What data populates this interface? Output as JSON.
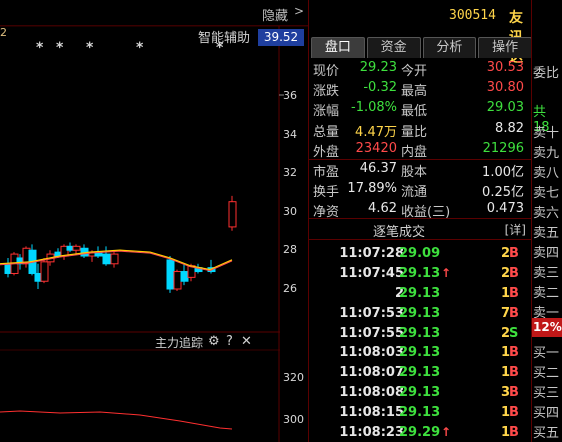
{
  "chart": {
    "hide_label": "隐藏",
    "collapse_icon": ">",
    "smart_assist": "智能辅助",
    "current_price": "39.52",
    "top_left_fragment": "2",
    "y_labels": [
      "36",
      "34",
      "32",
      "30",
      "28",
      "26"
    ],
    "lower_title": "主力追踪",
    "lower_y_labels": [
      "320",
      "300"
    ],
    "settings_icon": "gear-icon",
    "help_label": "?",
    "close_label": "✕",
    "colors": {
      "up": "#ff3030",
      "down": "#00d8ff",
      "ma": "#ffd000",
      "ma2": "#ff5050"
    }
  },
  "header": {
    "code": "300514",
    "name": "友讯达"
  },
  "tabs": [
    "盘口",
    "资金",
    "分析",
    "操作"
  ],
  "quote": {
    "rows": [
      {
        "l1": "现价",
        "v1": "29.23",
        "c1": "green",
        "l2": "今开",
        "v2": "30.53",
        "c2": "red"
      },
      {
        "l1": "涨跌",
        "v1": "-0.32",
        "c1": "green",
        "l2": "最高",
        "v2": "30.80",
        "c2": "red"
      },
      {
        "l1": "涨幅",
        "v1": "-1.08%",
        "c1": "green",
        "l2": "最低",
        "v2": "29.03",
        "c2": "green"
      },
      {
        "l1": "总量",
        "v1": "4.47万",
        "c1": "yellow",
        "l2": "量比",
        "v2": "8.82",
        "c2": "white"
      },
      {
        "l1": "外盘",
        "v1": "23420",
        "c1": "red",
        "l2": "内盘",
        "v2": "21296",
        "c2": "green"
      },
      {
        "l1": "市盈",
        "v1": "46.37",
        "c1": "white",
        "l2": "股本",
        "v2": "1.00亿",
        "c2": "white"
      },
      {
        "l1": "换手",
        "v1": "17.89%",
        "c1": "white",
        "l2": "流通",
        "v2": "0.25亿",
        "c2": "white"
      },
      {
        "l1": "净资",
        "v1": "4.62",
        "c1": "white",
        "l2": "收益(三)",
        "v2": "0.473",
        "c2": "white"
      }
    ]
  },
  "trades": {
    "title": "逐笔成交",
    "detail": "[详]",
    "rows": [
      {
        "time": "11:07:28",
        "price": "29.09",
        "arrow": "",
        "vol": "2",
        "dir": "B",
        "dircolor": "red"
      },
      {
        "time": "11:07:45",
        "price": "29.13",
        "arrow": "↑",
        "vol": "2",
        "dir": "B",
        "dircolor": "red"
      },
      {
        "time": "2",
        "price": "29.13",
        "arrow": "",
        "vol": "1",
        "dir": "B",
        "dircolor": "red"
      },
      {
        "time": "11:07:53",
        "price": "29.13",
        "arrow": "",
        "vol": "7",
        "dir": "B",
        "dircolor": "red"
      },
      {
        "time": "11:07:55",
        "price": "29.13",
        "arrow": "",
        "vol": "2",
        "dir": "S",
        "dircolor": "green"
      },
      {
        "time": "11:08:03",
        "price": "29.13",
        "arrow": "",
        "vol": "1",
        "dir": "B",
        "dircolor": "red"
      },
      {
        "time": "11:08:07",
        "price": "29.13",
        "arrow": "",
        "vol": "1",
        "dir": "B",
        "dircolor": "red"
      },
      {
        "time": "11:08:08",
        "price": "29.13",
        "arrow": "",
        "vol": "3",
        "dir": "B",
        "dircolor": "red"
      },
      {
        "time": "11:08:15",
        "price": "29.13",
        "arrow": "",
        "vol": "1",
        "dir": "B",
        "dircolor": "red"
      },
      {
        "time": "11:08:23",
        "price": "29.29",
        "arrow": "↑",
        "vol": "1",
        "dir": "B",
        "dircolor": "red"
      }
    ]
  },
  "strip": {
    "labels": [
      "委比",
      "",
      "共18",
      "卖十",
      "卖九",
      "卖八",
      "卖七",
      "卖六",
      "卖五",
      "卖四",
      "卖三",
      "卖二",
      "卖一",
      "",
      "买一",
      "买二",
      "买三",
      "买四",
      "买五"
    ],
    "pct": "12%"
  },
  "candles": [
    {
      "o": 27.3,
      "h": 27.6,
      "l": 26.6,
      "c": 26.8
    },
    {
      "o": 26.8,
      "h": 27.9,
      "l": 26.7,
      "c": 27.8
    },
    {
      "o": 27.6,
      "h": 27.8,
      "l": 27.0,
      "c": 27.3
    },
    {
      "o": 27.3,
      "h": 28.2,
      "l": 27.1,
      "c": 28.1
    },
    {
      "o": 28.0,
      "h": 28.3,
      "l": 26.7,
      "c": 26.8
    },
    {
      "o": 26.8,
      "h": 27.3,
      "l": 26.0,
      "c": 26.4
    },
    {
      "o": 26.4,
      "h": 27.6,
      "l": 26.3,
      "c": 27.4
    },
    {
      "o": 27.4,
      "h": 28.0,
      "l": 27.2,
      "c": 27.8
    },
    {
      "o": 27.9,
      "h": 28.1,
      "l": 27.6,
      "c": 27.7
    },
    {
      "o": 27.7,
      "h": 28.3,
      "l": 27.5,
      "c": 28.2
    },
    {
      "o": 28.2,
      "h": 28.4,
      "l": 27.9,
      "c": 28.0
    },
    {
      "o": 28.0,
      "h": 28.3,
      "l": 27.8,
      "c": 28.2
    },
    {
      "o": 28.1,
      "h": 28.3,
      "l": 27.6,
      "c": 27.7
    },
    {
      "o": 27.7,
      "h": 28.0,
      "l": 27.4,
      "c": 27.9
    },
    {
      "o": 27.9,
      "h": 28.2,
      "l": 27.6,
      "c": 27.7
    },
    {
      "o": 27.8,
      "h": 28.2,
      "l": 27.2,
      "c": 27.3
    },
    {
      "o": 27.3,
      "h": 27.9,
      "l": 27.1,
      "c": 27.8
    },
    {
      "o": 27.5,
      "h": 27.7,
      "l": 25.8,
      "c": 26.0
    },
    {
      "o": 26.0,
      "h": 27.0,
      "l": 25.9,
      "c": 26.9
    },
    {
      "o": 26.9,
      "h": 27.3,
      "l": 26.2,
      "c": 26.4
    },
    {
      "o": 26.6,
      "h": 27.3,
      "l": 26.4,
      "c": 27.2
    },
    {
      "o": 27.1,
      "h": 27.3,
      "l": 26.8,
      "c": 26.9
    },
    {
      "o": 27.1,
      "h": 27.5,
      "l": 26.8,
      "c": 26.9
    },
    {
      "o": 29.2,
      "h": 30.8,
      "l": 29.0,
      "c": 30.5
    }
  ]
}
